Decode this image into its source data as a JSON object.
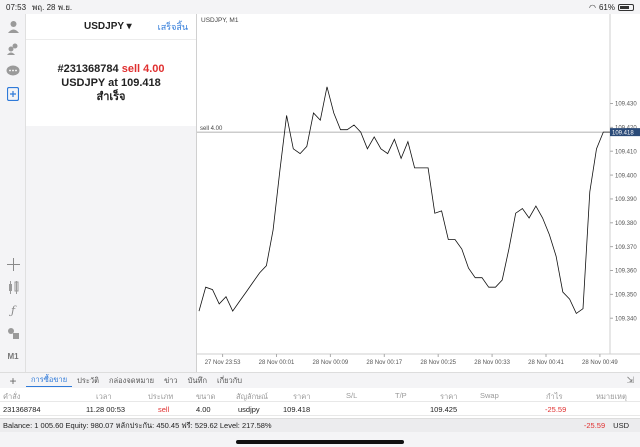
{
  "status": {
    "time": "07:53",
    "date": "พฤ. 28 พ.ย.",
    "battery": "61%"
  },
  "left_icons": [
    "user-icon",
    "accounts-icon",
    "chat-icon",
    "new-order-icon",
    "crosshair-icon",
    "indicators-icon",
    "function-icon",
    "objects-icon",
    "timeframe-icon"
  ],
  "timeframe_label": "M1",
  "trade": {
    "symbol": "USDJPY ▾",
    "done": "เสร็จสิ้น",
    "ticket": "#231368784",
    "action": "sell 4.00",
    "line2_prefix": "USDJPY at",
    "line2_price": "109.418",
    "result": "สำเร็จ"
  },
  "chart_data": {
    "type": "line",
    "title": "USDJPY, M1",
    "sell_line_label": "sell 4.00",
    "sell_price": 109.418,
    "current_price_label": "109.418",
    "ylim": [
      109.325,
      109.465
    ],
    "y_ticks": [
      "109.430",
      "109.420",
      "109.410",
      "109.400",
      "109.390",
      "109.380",
      "109.370",
      "109.360",
      "109.350",
      "109.340"
    ],
    "x_ticks": [
      "27 Nov 23:53",
      "28 Nov 00:01",
      "28 Nov 00:09",
      "28 Nov 00:17",
      "28 Nov 00:25",
      "28 Nov 00:33",
      "28 Nov 00:41",
      "28 Nov 00:49"
    ],
    "x_tick_pos": [
      1,
      9,
      17,
      25,
      33,
      41,
      49,
      57
    ],
    "x_range": [
      -2.5,
      58.5
    ],
    "x": [
      -2.5,
      -1.5,
      -0.5,
      0.5,
      1.5,
      2.5,
      3.5,
      4.5,
      5.5,
      6.5,
      7.5,
      8.5,
      9.5,
      10.5,
      11.5,
      12.5,
      13.5,
      14.5,
      15.5,
      16.5,
      17.5,
      18.5,
      19.5,
      20.5,
      21.5,
      22.5,
      23.5,
      24.5,
      25.5,
      26.5,
      27.5,
      28.5,
      29.5,
      30.5,
      31.5,
      32.5,
      33.5,
      34.5,
      35.5,
      36.5,
      37.5,
      38.5,
      39.5,
      40.5,
      41.5,
      42.5,
      43.5,
      44.5,
      45.5,
      46.5,
      47.5,
      48.5,
      49.5,
      50.5,
      51.5,
      52.5,
      53.5,
      54.5,
      55.5,
      56.5,
      57.5,
      58.5
    ],
    "y": [
      109.343,
      109.353,
      109.352,
      109.346,
      109.349,
      109.343,
      109.347,
      109.351,
      109.355,
      109.359,
      109.362,
      109.377,
      109.402,
      109.425,
      109.411,
      109.409,
      109.412,
      109.426,
      109.423,
      109.437,
      109.426,
      109.419,
      109.419,
      109.421,
      109.418,
      109.411,
      109.416,
      109.411,
      109.409,
      109.415,
      109.407,
      109.414,
      109.403,
      109.403,
      109.403,
      109.384,
      109.385,
      109.373,
      109.373,
      109.369,
      109.361,
      109.357,
      109.357,
      109.353,
      109.353,
      109.356,
      109.369,
      109.384,
      109.386,
      109.382,
      109.387,
      109.382,
      109.375,
      109.366,
      109.351,
      109.348,
      109.342,
      109.344,
      109.393,
      109.411,
      109.418,
      109.418
    ]
  },
  "tabs": {
    "items": [
      "การซื้อขาย",
      "ประวัติ",
      "กล่องจดหมาย",
      "ข่าว",
      "บันทึก",
      "เกี่ยวกับ"
    ],
    "active": 0
  },
  "table": {
    "headers": [
      "คำสั่ง",
      "เวลา",
      "ประเภท",
      "ขนาด",
      "สัญลักษณ์",
      "ราคา",
      "S/L",
      "T/P",
      "ราคา",
      "Swap",
      "กำไร",
      "หมายเหตุ"
    ],
    "row": [
      "231368784",
      "11.28 00:53",
      "sell",
      "4.00",
      "usdjpy",
      "109.418",
      "",
      "",
      "109.425",
      "",
      "-25.59",
      ""
    ]
  },
  "balance": {
    "text": "Balance: 1 005.60 Equity: 980.07 หลักประกัน: 450.45 ฟรี: 529.62 Level: 217.58%",
    "profit": "-25.59",
    "currency": "USD"
  }
}
